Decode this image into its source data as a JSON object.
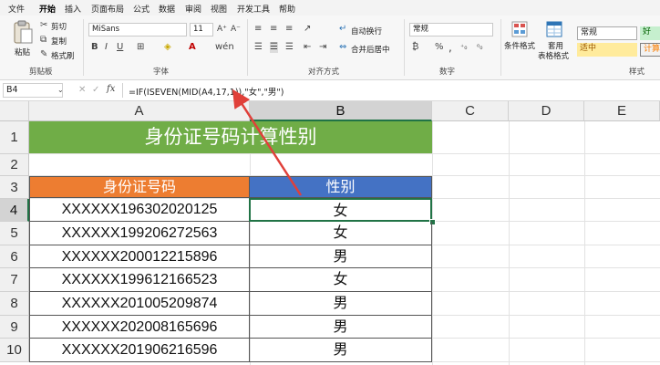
{
  "menu": [
    "文件",
    "开始",
    "插入",
    "页面布局",
    "公式",
    "数据",
    "审阅",
    "视图",
    "开发工具",
    "帮助"
  ],
  "active_menu": "开始",
  "ribbon": {
    "clipboard": {
      "paste": "粘贴",
      "cut": "剪切",
      "copy": "复制",
      "format_painter": "格式刷",
      "label": "剪贴板"
    },
    "font": {
      "name": "MiSans",
      "size": "11",
      "label": "字体"
    },
    "alignment": {
      "wrap": "自动换行",
      "merge": "合并后居中",
      "label": "对齐方式"
    },
    "number": {
      "format": "常规",
      "label": "数字"
    },
    "styles": {
      "conditional": "条件格式",
      "table_line1": "套用",
      "table_line2": "表格格式",
      "normal": "常规",
      "good": "好",
      "neutral": "适中",
      "calc": "计算",
      "label": "样式"
    }
  },
  "formula_bar": {
    "name_box": "B4",
    "fx": "fx",
    "formula": "=IF(ISEVEN(MID(A4,17,1)),\"女\",\"男\")"
  },
  "columns": [
    "A",
    "B",
    "C",
    "D",
    "E"
  ],
  "rows": [
    "1",
    "2",
    "3",
    "4",
    "5",
    "6",
    "7",
    "8",
    "9",
    "10"
  ],
  "sheet": {
    "title": "身份证号码计算性别",
    "header_a": "身份证号码",
    "header_b": "性别",
    "data": [
      {
        "id": "XXXXXX196302020125",
        "gender": "女"
      },
      {
        "id": "XXXXXX199206272563",
        "gender": "女"
      },
      {
        "id": "XXXXXX200012215896",
        "gender": "男"
      },
      {
        "id": "XXXXXX199612166523",
        "gender": "女"
      },
      {
        "id": "XXXXXX201005209874",
        "gender": "男"
      },
      {
        "id": "XXXXXX202008165696",
        "gender": "男"
      },
      {
        "id": "XXXXXX201906216596",
        "gender": "男"
      }
    ]
  },
  "colors": {
    "title_bg": "#70ad47",
    "header_a_bg": "#ed7d31",
    "header_b_bg": "#4472c4",
    "accent": "#107c41",
    "arrow": "#e0403a"
  }
}
